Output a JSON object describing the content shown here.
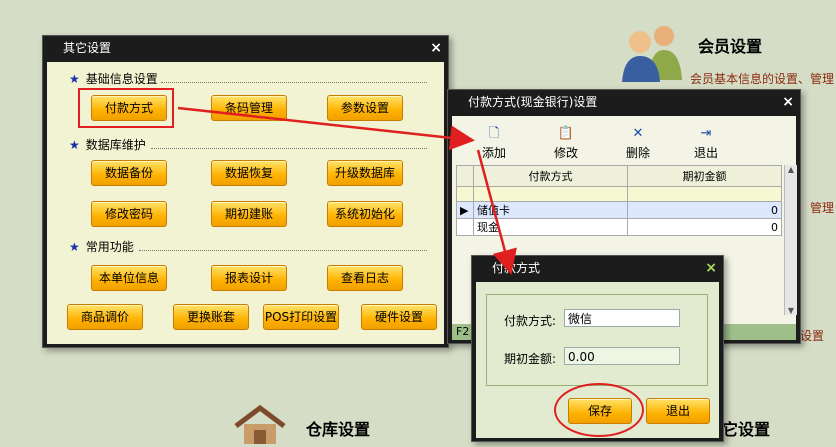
{
  "background": {
    "member_title": "会员设置",
    "member_desc": "会员基本信息的设置、管理",
    "side_manage": "管理",
    "side_settings": "设置",
    "warehouse_title": "仓库设置",
    "other_title_tail": "它设置"
  },
  "other_settings": {
    "title": "其它设置",
    "close": "×",
    "sections": {
      "basic": "基础信息设置",
      "database": "数据库维护",
      "common": "常用功能"
    },
    "buttons": {
      "payment_method": "付款方式",
      "barcode": "条码管理",
      "params": "参数设置",
      "backup": "数据备份",
      "restore": "数据恢复",
      "upgrade": "升级数据库",
      "change_pwd": "修改密码",
      "period_init": "期初建账",
      "sys_init": "系统初始化",
      "unit_info": "本单位信息",
      "report_design": "报表设计",
      "view_log": "查看日志",
      "price_adjust": "商品调价",
      "switch_account": "更换账套",
      "pos_print": "POS打印设置",
      "hardware": "硬件设置"
    }
  },
  "payment_window": {
    "title": "付款方式(现金银行)设置",
    "close": "×",
    "toolbar": {
      "add": "添加",
      "edit": "修改",
      "delete": "删除",
      "exit": "退出"
    },
    "columns": [
      "付款方式",
      "期初金额"
    ],
    "rows": [
      {
        "method": "储值卡",
        "amount": "0"
      },
      {
        "method": "现金",
        "amount": "0"
      }
    ],
    "footer_tag": "F2"
  },
  "payment_dialog": {
    "title": "付款方式",
    "close": "×",
    "method_label": "付款方式:",
    "method_value": "微信",
    "amount_label": "期初金额:",
    "amount_value": "0.00",
    "save": "保存",
    "exit": "退出"
  },
  "colors": {
    "accent_orange": "#ffb200",
    "annotation_red": "#e02020",
    "window_dark": "#1c1c1c"
  }
}
